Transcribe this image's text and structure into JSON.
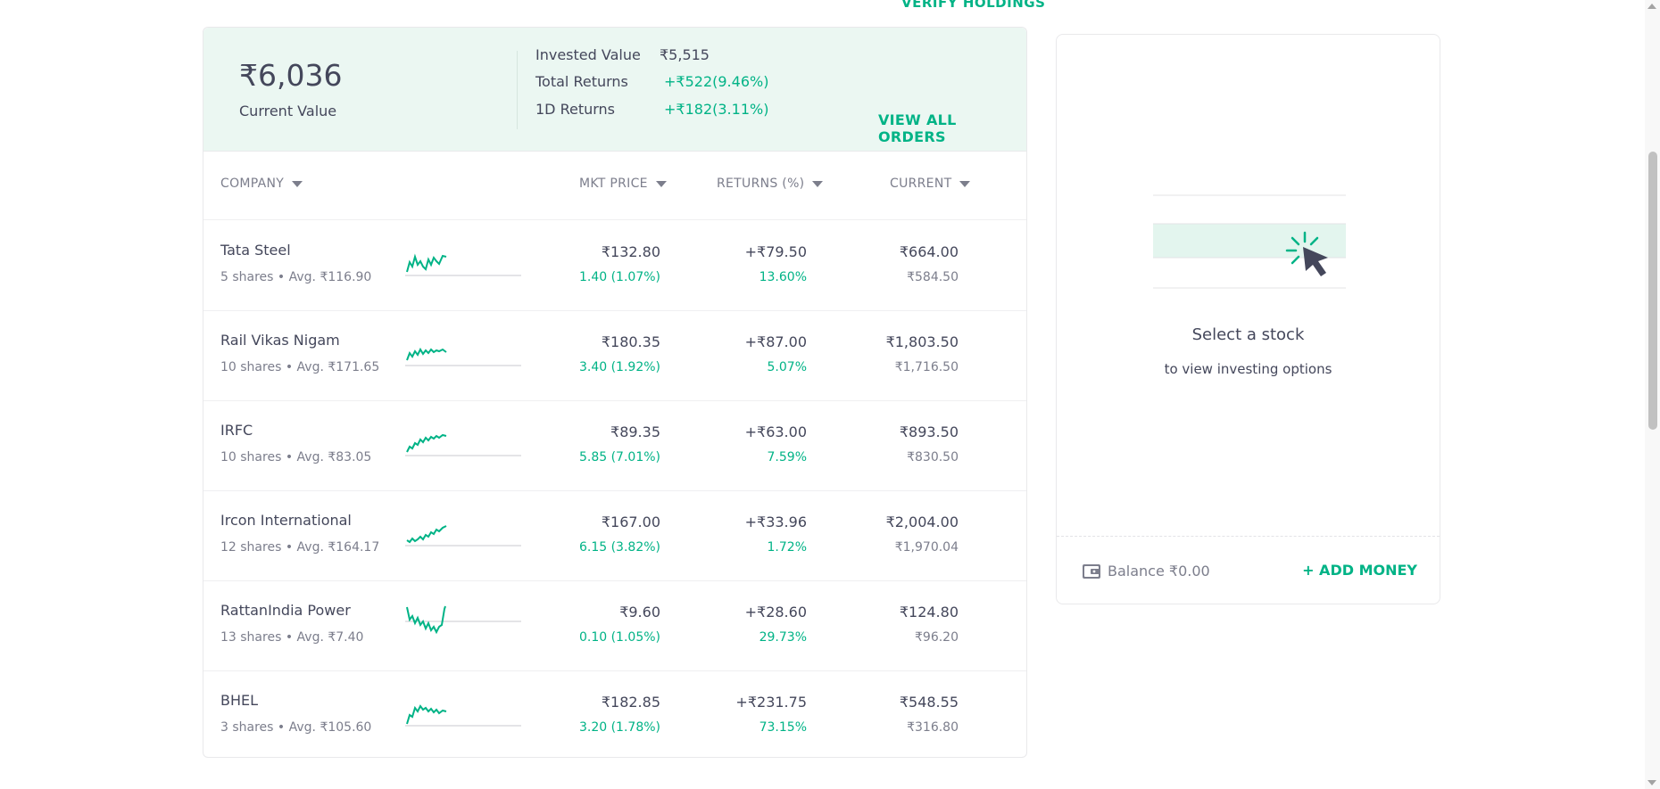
{
  "header": {
    "verify_holdings": "VERIFY HOLDINGS"
  },
  "summary": {
    "current_value": "₹6,036",
    "current_value_label": "Current Value",
    "invested_label": "Invested Value",
    "invested_value": "₹5,515",
    "total_returns_label": "Total Returns",
    "total_returns_value": "+₹522(9.46%)",
    "one_day_label": "1D Returns",
    "one_day_value": "+₹182(3.11%)",
    "view_all_orders": "VIEW ALL ORDERS"
  },
  "table": {
    "headers": {
      "company": "COMPANY",
      "mkt_price": "MKT PRICE",
      "returns": "RETURNS (%)",
      "current": "CURRENT"
    },
    "rows": [
      {
        "name": "Tata Steel",
        "sub": "5 shares • Avg. ₹116.90",
        "mkt_price": "₹132.80",
        "mkt_change": "1.40 (1.07%)",
        "returns": "+₹79.50",
        "returns_pct": "13.60%",
        "current": "₹664.00",
        "invested": "₹584.50"
      },
      {
        "name": "Rail Vikas Nigam",
        "sub": "10 shares • Avg. ₹171.65",
        "mkt_price": "₹180.35",
        "mkt_change": "3.40 (1.92%)",
        "returns": "+₹87.00",
        "returns_pct": "5.07%",
        "current": "₹1,803.50",
        "invested": "₹1,716.50"
      },
      {
        "name": "IRFC",
        "sub": "10 shares • Avg. ₹83.05",
        "mkt_price": "₹89.35",
        "mkt_change": "5.85 (7.01%)",
        "returns": "+₹63.00",
        "returns_pct": "7.59%",
        "current": "₹893.50",
        "invested": "₹830.50"
      },
      {
        "name": "Ircon International",
        "sub": "12 shares • Avg. ₹164.17",
        "mkt_price": "₹167.00",
        "mkt_change": "6.15 (3.82%)",
        "returns": "+₹33.96",
        "returns_pct": "1.72%",
        "current": "₹2,004.00",
        "invested": "₹1,970.04"
      },
      {
        "name": "RattanIndia Power",
        "sub": "13 shares • Avg. ₹7.40",
        "mkt_price": "₹9.60",
        "mkt_change": "0.10 (1.05%)",
        "returns": "+₹28.60",
        "returns_pct": "29.73%",
        "current": "₹124.80",
        "invested": "₹96.20"
      },
      {
        "name": "BHEL",
        "sub": "3 shares • Avg. ₹105.60",
        "mkt_price": "₹182.85",
        "mkt_change": "3.20 (1.78%)",
        "returns": "+₹231.75",
        "returns_pct": "73.15%",
        "current": "₹548.55",
        "invested": "₹316.80"
      }
    ]
  },
  "side": {
    "title": "Select a stock",
    "subtitle": "to view investing options",
    "balance": "Balance ₹0.00",
    "add_money": "+ ADD MONEY"
  },
  "colors": {
    "accent": "#00b386",
    "summary_bg": "#ebf7f2",
    "text": "#44475b",
    "muted": "#7c7e8c"
  },
  "icons": [
    "caret-down-icon",
    "sparkline-icon",
    "cursor-click-icon",
    "wallet-icon"
  ]
}
